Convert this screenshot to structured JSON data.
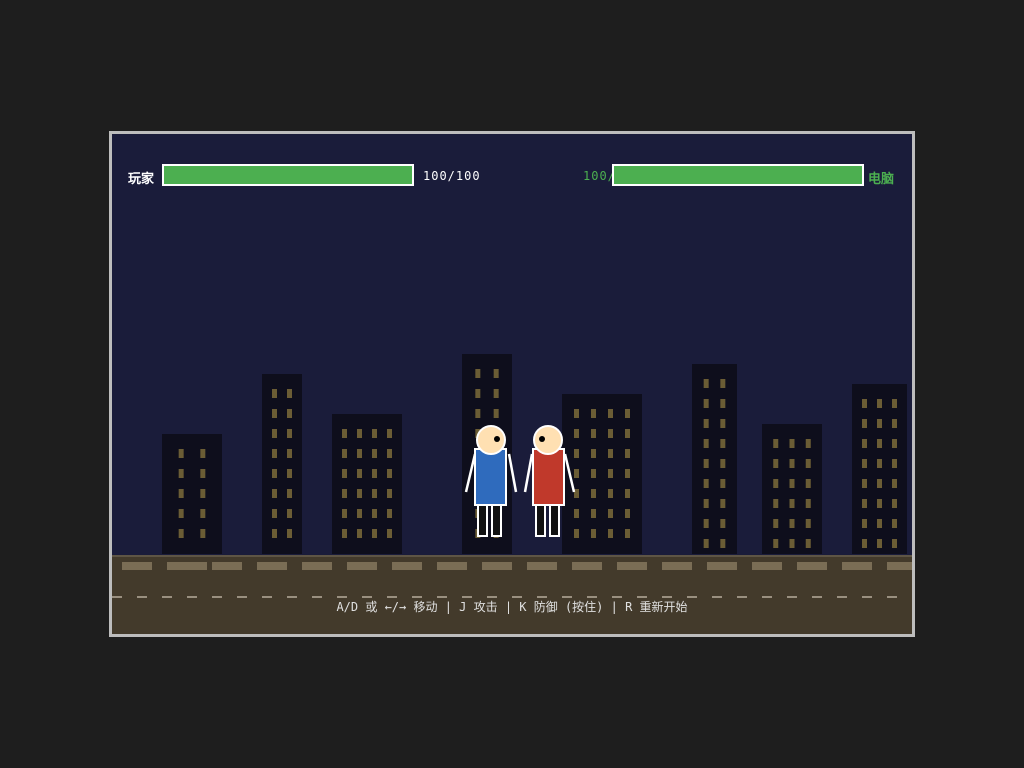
{
  "player": {
    "name": "玩家",
    "hp_text": "100/100",
    "hp": 100,
    "hp_max": 100,
    "color": "#2f6bbd"
  },
  "cpu": {
    "name": "电脑",
    "hp_text": "100/100",
    "hp": 100,
    "hp_max": 100,
    "color": "#c0392b"
  },
  "colors": {
    "sky": "#1a1c3a",
    "building": "#0e0e1c",
    "window": "#6b5d35",
    "health": "#4caf50",
    "cpu_text": "#4caf50",
    "ground": "#433a2b"
  },
  "controls_text": "A/D 或 ←/→ 移动 | J 攻击 | K 防御 (按住) | R 重新开始"
}
